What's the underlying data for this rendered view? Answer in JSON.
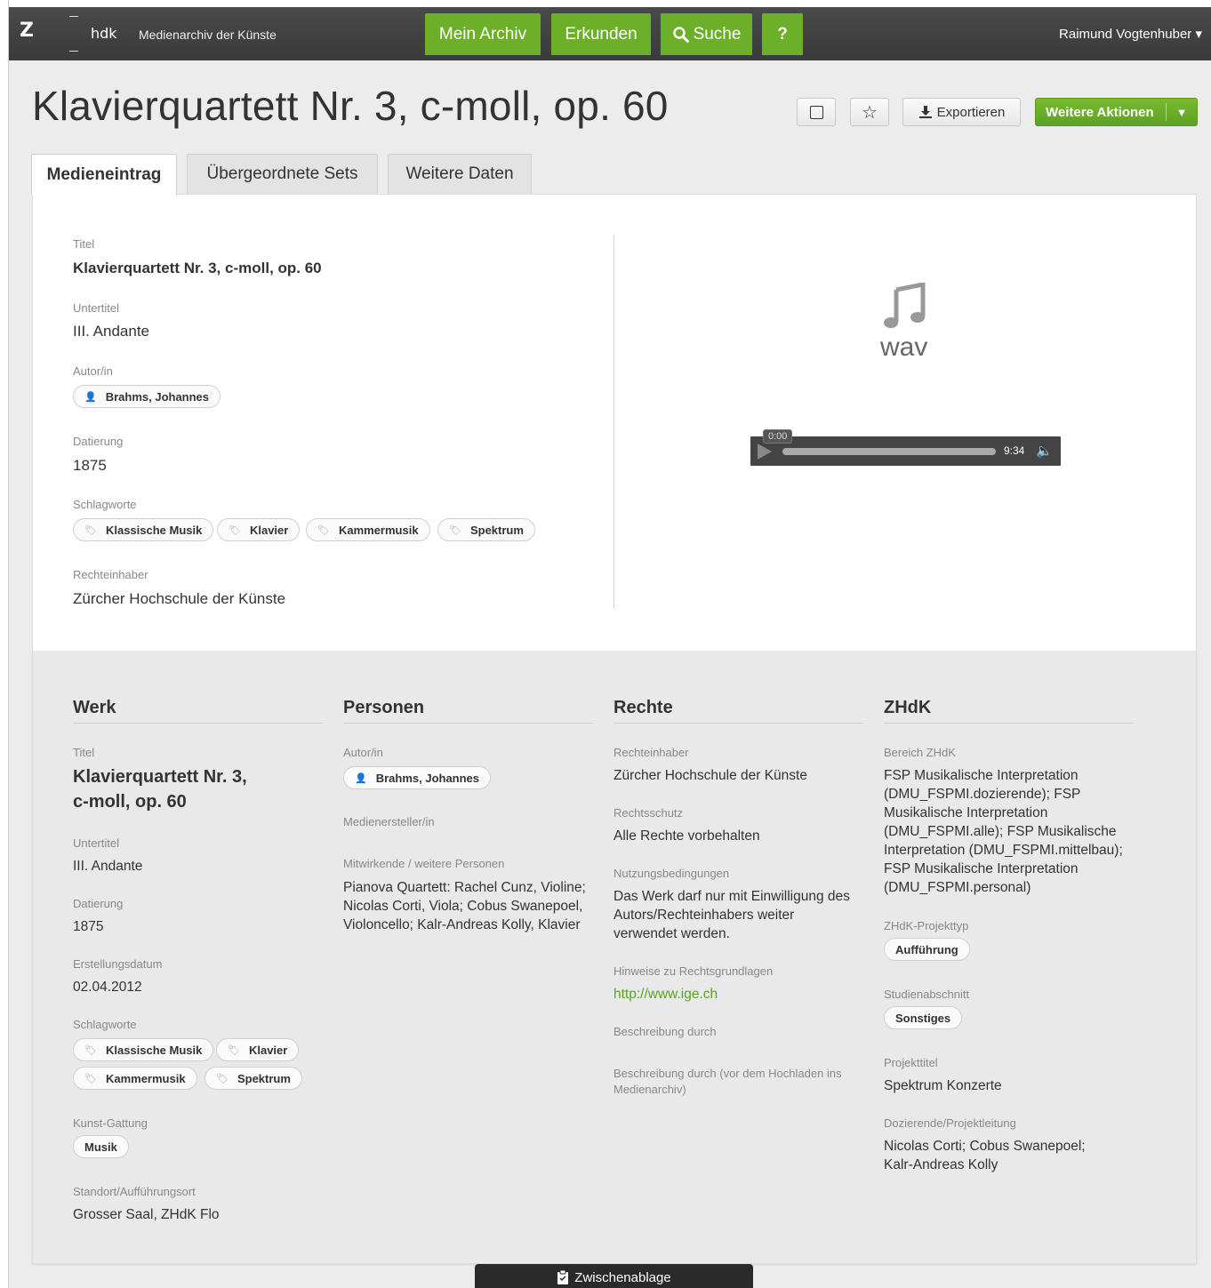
{
  "header": {
    "logo_z": "Z",
    "logo_hdk": "hdk",
    "app_name": "Medienarchiv der Künste",
    "nav": [
      "Mein Archiv",
      "Erkunden",
      "Suche",
      "?"
    ],
    "user": "Raimund Vogtenhuber ▾"
  },
  "entry": {
    "title": "Klavierquartett Nr. 3, c-moll, op. 60",
    "export_label": "Exportieren",
    "more_actions_label": "Weitere Aktionen"
  },
  "tabs": [
    "Medieneintrag",
    "Übergeordnete Sets",
    "Weitere Daten"
  ],
  "summary": {
    "titel_label": "Titel",
    "titel": "Klavierquartett Nr. 3, c-moll, op. 60",
    "untertitel_label": "Untertitel",
    "untertitel": "III. Andante",
    "autor_label": "Autor/in",
    "autor": "Brahms, Johannes",
    "datierung_label": "Datierung",
    "datierung": "1875",
    "schlagworte_label": "Schlagworte",
    "schlagworte": [
      "Klassische Musik",
      "Klavier",
      "Kammermusik",
      "Spektrum"
    ],
    "rechteinhaber_label": "Rechteinhaber",
    "rechteinhaber": "Zürcher Hochschule der Künste"
  },
  "media": {
    "format": "wav",
    "current_time": "0:00",
    "duration": "9:34"
  },
  "werk": {
    "heading": "Werk",
    "titel_label": "Titel",
    "titel_line1": "Klavierquartett Nr. 3,",
    "titel_line2": "c-moll, op. 60",
    "untertitel_label": "Untertitel",
    "untertitel": "III. Andante",
    "datierung_label": "Datierung",
    "datierung": "1875",
    "erstellungsdatum_label": "Erstellungsdatum",
    "erstellungsdatum": "02.04.2012",
    "schlagworte_label": "Schlagworte",
    "schlagworte": [
      "Klassische Musik",
      "Klavier",
      "Kammermusik",
      "Spektrum"
    ],
    "gattung_label": "Kunst-Gattung",
    "gattung": "Musik",
    "standort_label": "Standort/Aufführungsort",
    "standort": "Grosser Saal, ZHdK Flo"
  },
  "personen": {
    "heading": "Personen",
    "autor_label": "Autor/in",
    "autor": "Brahms, Johannes",
    "medienersteller_label": "Medienersteller/in",
    "mitwirkende_label": "Mitwirkende / weitere Personen",
    "mitwirkende": [
      "Pianova Quartett: Rachel Cunz, Violine;",
      "Nicolas Corti, Viola; Cobus Swanepoel,",
      "Violoncello; Kalr-Andreas Kolly, Klavier"
    ]
  },
  "rechte": {
    "heading": "Rechte",
    "rechteinhaber_label": "Rechteinhaber",
    "rechteinhaber": "Zürcher Hochschule der Künste",
    "rechtsschutz_label": "Rechtsschutz",
    "rechtsschutz": "Alle Rechte vorbehalten",
    "nutzung_label": "Nutzungsbedingungen",
    "nutzung": [
      "Das Werk darf nur mit Einwilligung des",
      "Autors/Rechteinhabers weiter",
      "verwendet werden."
    ],
    "hinweise_label": "Hinweise zu Rechtsgrundlagen",
    "hinweise_link": "http://www.ige.ch",
    "beschreibung_label": "Beschreibung durch",
    "beschreibung_vor_label": [
      "Beschreibung durch (vor dem Hochladen ins",
      "Medienarchiv)"
    ]
  },
  "zhdk": {
    "heading": "ZHdK",
    "bereich_label": "Bereich ZHdK",
    "bereich": [
      "FSP Musikalische Interpretation",
      "(DMU_FSPMI.dozierende); FSP",
      "Musikalische Interpretation",
      "(DMU_FSPMI.alle); FSP Musikalische",
      "Interpretation (DMU_FSPMI.mittelbau);",
      "FSP Musikalische Interpretation",
      "(DMU_FSPMI.personal)"
    ],
    "projekttyp_label": "ZHdK-Projekttyp",
    "projekttyp": "Aufführung",
    "studienabschnitt_label": "Studienabschnitt",
    "studienabschnitt": "Sonstiges",
    "projekttitel_label": "Projekttitel",
    "projekttitel": "Spektrum Konzerte",
    "dozierende_label": "Dozierende/Projektleitung",
    "dozierende": [
      "Nicolas Corti; Cobus Swanepoel;",
      "Kalr-Andreas Kolly"
    ]
  },
  "clipboard_label": "Zwischenablage",
  "colors": {
    "accent_green": "#6cb02a",
    "topbar": "#3f3f3f"
  }
}
